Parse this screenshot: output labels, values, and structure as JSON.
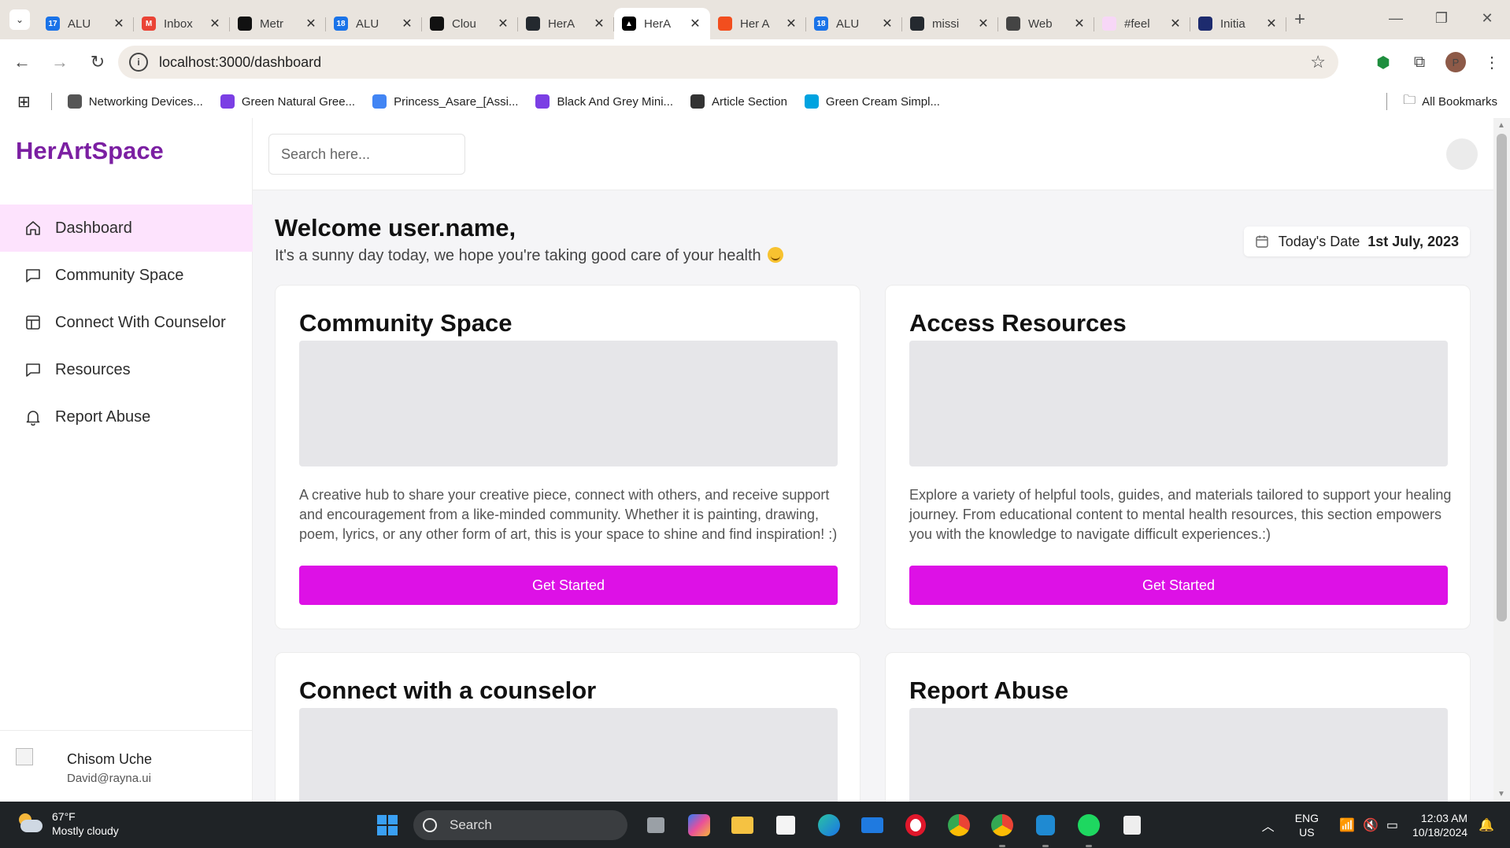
{
  "browser": {
    "tabs": [
      {
        "label": "ALU",
        "fav_color": "#1a73e8",
        "fav_text": "17",
        "active": false
      },
      {
        "label": "Inbox",
        "fav_color": "#ea4335",
        "fav_text": "M",
        "active": false
      },
      {
        "label": "Metr",
        "fav_color": "#111111",
        "fav_text": "",
        "active": false
      },
      {
        "label": "ALU",
        "fav_color": "#1a73e8",
        "fav_text": "18",
        "active": false
      },
      {
        "label": "Clou",
        "fav_color": "#111111",
        "fav_text": "",
        "active": false
      },
      {
        "label": "HerA",
        "fav_color": "#24292f",
        "fav_text": "",
        "active": false
      },
      {
        "label": "HerA",
        "fav_color": "#000000",
        "fav_text": "▲",
        "active": true
      },
      {
        "label": "Her A",
        "fav_color": "#f24e1e",
        "fav_text": "",
        "active": false
      },
      {
        "label": "ALU",
        "fav_color": "#1a73e8",
        "fav_text": "18",
        "active": false
      },
      {
        "label": "missi",
        "fav_color": "#24292f",
        "fav_text": "",
        "active": false
      },
      {
        "label": "Web",
        "fav_color": "#444444",
        "fav_text": "",
        "active": false
      },
      {
        "label": "#feel",
        "fav_color": "#f7d7f7",
        "fav_text": "",
        "active": false
      },
      {
        "label": "Initia",
        "fav_color": "#1d2b6e",
        "fav_text": "",
        "active": false
      }
    ],
    "url": "localhost:3000/dashboard",
    "profile_initial": "P",
    "bookmarks": [
      {
        "label": "Networking Devices...",
        "color": "#555555"
      },
      {
        "label": "Green Natural Gree...",
        "color": "#7b3fe4"
      },
      {
        "label": "Princess_Asare_[Assi...",
        "color": "#4285f4"
      },
      {
        "label": "Black And Grey Mini...",
        "color": "#7b3fe4"
      },
      {
        "label": "Article Section",
        "color": "#333333"
      },
      {
        "label": "Green Cream Simpl...",
        "color": "#00a3e0"
      }
    ],
    "all_bookmarks": "All Bookmarks"
  },
  "app": {
    "brand": "HerArtSpace",
    "nav": [
      {
        "label": "Dashboard",
        "icon": "home-icon",
        "active": true
      },
      {
        "label": "Community Space",
        "icon": "chat-icon",
        "active": false
      },
      {
        "label": "Connect With Counselor",
        "icon": "layout-icon",
        "active": false
      },
      {
        "label": "Resources",
        "icon": "chat-icon",
        "active": false
      },
      {
        "label": "Report Abuse",
        "icon": "bell-icon",
        "active": false
      }
    ],
    "user": {
      "name": "Chisom Uche",
      "email": "David@rayna.ui"
    },
    "search_placeholder": "Search here...",
    "welcome": "Welcome user.name,",
    "subtitle": "It's a sunny day today, we hope you're taking good care of your health",
    "date_label": "Today's Date",
    "date_value": "1st July, 2023",
    "cards": [
      {
        "title": "Community Space",
        "text": "A creative hub to share your creative piece, connect with others, and receive support and encouragement from a like-minded community. Whether it is painting, drawing, poem, lyrics, or any other form of art, this is your space to shine and find inspiration! :)",
        "cta": "Get Started"
      },
      {
        "title": "Access Resources",
        "text": "Explore a variety of helpful tools, guides, and materials tailored to support your healing journey. From educational content to mental health resources, this section empowers you with the knowledge to navigate difficult experiences.:)",
        "cta": "Get Started"
      },
      {
        "title": "Connect with a counselor"
      },
      {
        "title": "Report Abuse"
      }
    ],
    "accent": "#dd11e6",
    "brand_color": "#7b1fa2"
  },
  "taskbar": {
    "temp": "67°F",
    "condition": "Mostly cloudy",
    "search": "Search",
    "lang1": "ENG",
    "lang2": "US",
    "time": "12:03 AM",
    "date": "10/18/2024"
  }
}
